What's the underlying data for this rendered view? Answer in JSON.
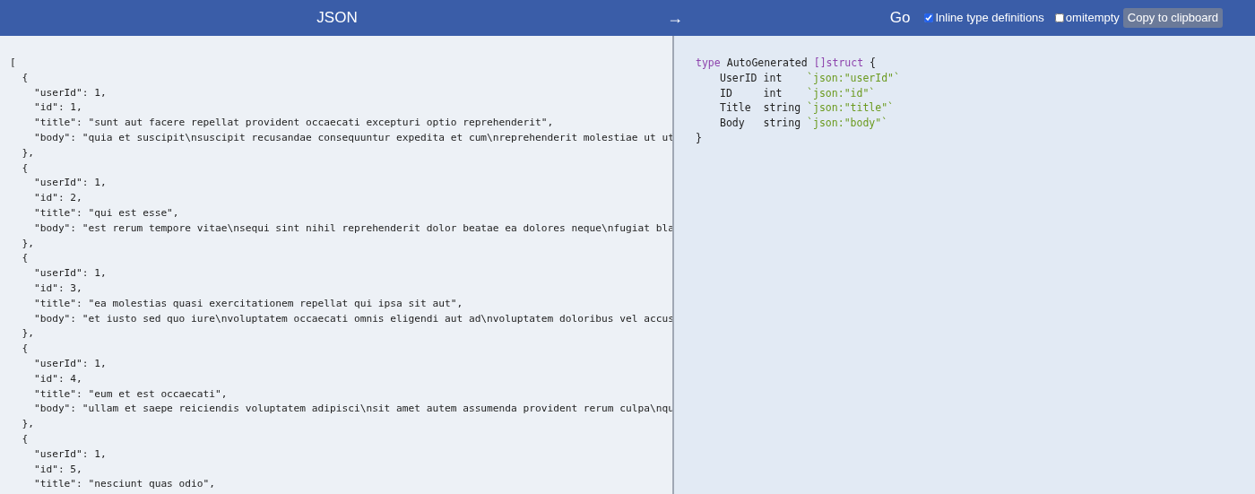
{
  "header": {
    "input_title": "JSON",
    "arrow": "→",
    "output_title": "Go",
    "options": [
      {
        "label": "Inline type definitions",
        "checked": true
      },
      {
        "label": "omitempty",
        "checked": false
      }
    ],
    "copy_button": "Copy to clipboard"
  },
  "json_input": {
    "lines": [
      "[",
      "  {",
      "    \"userId\": 1,",
      "    \"id\": 1,",
      "    \"title\": \"sunt aut facere repellat provident occaecati excepturi optio reprehenderit\",",
      "    \"body\": \"quia et suscipit\\nsuscipit recusandae consequuntur expedita et cum\\nreprehenderit molestiae ut ut",
      "  },",
      "  {",
      "    \"userId\": 1,",
      "    \"id\": 2,",
      "    \"title\": \"qui est esse\",",
      "    \"body\": \"est rerum tempore vitae\\nsequi sint nihil reprehenderit dolor beatae ea dolores neque\\nfugiat bla",
      "  },",
      "  {",
      "    \"userId\": 1,",
      "    \"id\": 3,",
      "    \"title\": \"ea molestias quasi exercitationem repellat qui ipsa sit aut\",",
      "    \"body\": \"et iusto sed quo iure\\nvoluptatem occaecati omnis eligendi aut ad\\nvoluptatem doloribus vel accus",
      "  },",
      "  {",
      "    \"userId\": 1,",
      "    \"id\": 4,",
      "    \"title\": \"eum et est occaecati\",",
      "    \"body\": \"ullam et saepe reiciendis voluptatem adipisci\\nsit amet autem assumenda provident rerum culpa\\nqu",
      "  },",
      "  {",
      "    \"userId\": 1,",
      "    \"id\": 5,",
      "    \"title\": \"nesciunt quas odio\","
    ]
  },
  "go_output": {
    "keyword": "type",
    "name": "AutoGenerated",
    "type": "[]struct",
    "open": "{",
    "close": "}",
    "fields": [
      {
        "name": "UserID",
        "type": "int",
        "tag": "`json:\"userId\"`"
      },
      {
        "name": "ID",
        "type": "int",
        "tag": "`json:\"id\"`"
      },
      {
        "name": "Title",
        "type": "string",
        "tag": "`json:\"title\"`"
      },
      {
        "name": "Body",
        "type": "string",
        "tag": "`json:\"body\"`"
      }
    ]
  }
}
